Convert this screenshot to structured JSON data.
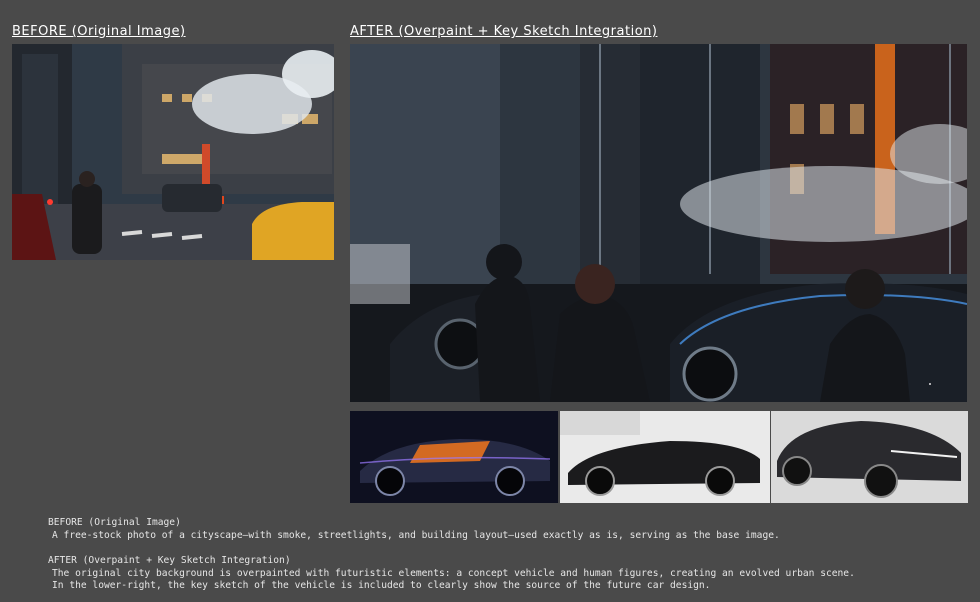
{
  "headings": {
    "before": "BEFORE (Original Image)",
    "after": "AFTER (Overpaint + Key Sketch Integration)"
  },
  "captions": {
    "before_title": "BEFORE (Original Image)",
    "before_body": "A free-stock photo of a cityscape—with smoke, streetlights, and building layout—used exactly as is, serving as the base image.",
    "after_title": "AFTER (Overpaint + Key Sketch Integration)",
    "after_body_1": "The original city background is overpainted with futuristic elements: a concept vehicle and human figures, creating an evolved urban scene.",
    "after_body_2": "In the lower-right, the key sketch of the vehicle is included to clearly show the source of the future car design."
  },
  "colors": {
    "background": "#4a4a4a",
    "heading_text": "#ffffff",
    "caption_text": "#e6e6e6",
    "taxi_yellow": "#e0a524",
    "steam": "#e9eef2",
    "accent_orange": "#ff7a1a",
    "accent_blue": "#4fa3ff"
  }
}
